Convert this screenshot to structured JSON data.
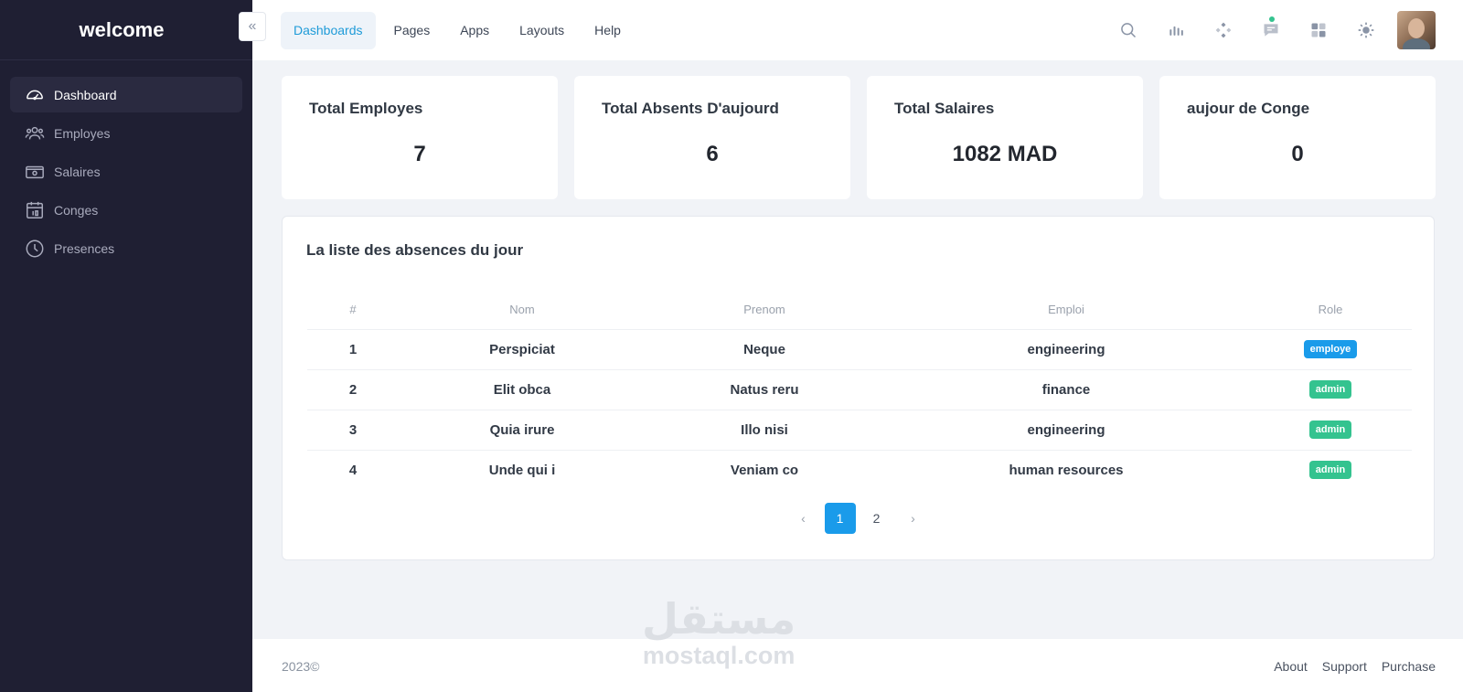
{
  "sidebar": {
    "brand": "welcome",
    "items": [
      {
        "label": "Dashboard",
        "icon": "gauge-icon",
        "active": true
      },
      {
        "label": "Employes",
        "icon": "users-icon"
      },
      {
        "label": "Salaires",
        "icon": "banknote-icon"
      },
      {
        "label": "Conges",
        "icon": "calendar-icon"
      },
      {
        "label": "Presences",
        "icon": "clock-icon"
      }
    ]
  },
  "header": {
    "collapse_icon": "double-chevron-left-icon",
    "menu": [
      "Dashboards",
      "Pages",
      "Apps",
      "Layouts",
      "Help"
    ],
    "icons": [
      "search-icon",
      "bar-chart-icon",
      "diamond-grid-icon",
      "chat-icon",
      "apps-grid-icon",
      "sun-icon",
      "avatar"
    ]
  },
  "stats": [
    {
      "label": "Total Employes",
      "value": "7"
    },
    {
      "label": "Total Absents D'aujourd",
      "value": "6"
    },
    {
      "label": "Total Salaires",
      "value": "1082 MAD"
    },
    {
      "label": "aujour de Conge",
      "value": "0"
    }
  ],
  "absences": {
    "title": "La liste des absences du jour",
    "columns": [
      "#",
      "Nom",
      "Prenom",
      "Emploi",
      "Role"
    ],
    "rows": [
      {
        "num": "1",
        "nom": "Perspiciat",
        "prenom": "Neque",
        "emploi": "engineering",
        "role": "employe"
      },
      {
        "num": "2",
        "nom": "Elit obca",
        "prenom": "Natus reru",
        "emploi": "finance",
        "role": "admin"
      },
      {
        "num": "3",
        "nom": "Quia irure",
        "prenom": "Illo nisi",
        "emploi": "engineering",
        "role": "admin"
      },
      {
        "num": "4",
        "nom": "Unde qui i",
        "prenom": "Veniam co",
        "emploi": "human resources",
        "role": "admin"
      }
    ]
  },
  "pagination": {
    "prev": "‹",
    "pages": [
      "1",
      "2"
    ],
    "current": "1",
    "next": "›"
  },
  "footer": {
    "copyright": "2023©",
    "links": [
      "About",
      "Support",
      "Purchase"
    ]
  },
  "watermark": {
    "arabic": "مستقل",
    "latin": "mostaql.com"
  },
  "colors": {
    "sidebar_bg": "#1f1f33",
    "accent": "#1a9bea",
    "admin_badge": "#34c38f",
    "page_bg": "#f1f3f7"
  }
}
